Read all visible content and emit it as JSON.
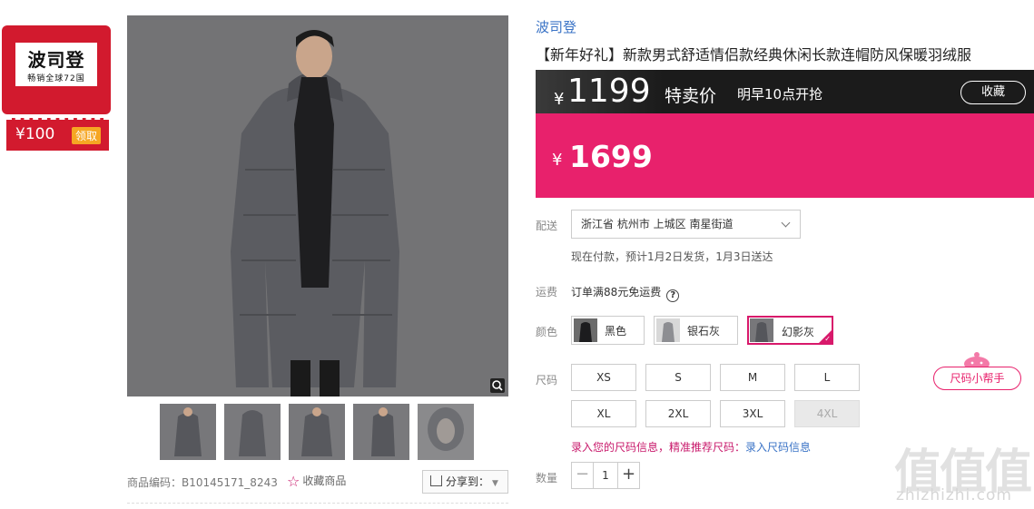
{
  "coupon": {
    "brand": "波司登",
    "slogan": "畅销全球72国",
    "amount": "¥100",
    "claim_label": "领取"
  },
  "gallery": {
    "thumb_count": 5
  },
  "meta": {
    "sku_code": "商品编码：B10145171_8243",
    "favorite_label": "收藏商品",
    "share_label": "分享到："
  },
  "product": {
    "brand": "波司登",
    "title": "【新年好礼】新款男式舒适情侣款经典休闲长款连帽防风保暖羽绒服"
  },
  "flash": {
    "currency": "¥",
    "price": "1199",
    "label": "特卖价",
    "time": "明早10点开抢",
    "favorite_button": "收藏"
  },
  "price": {
    "currency": "¥",
    "value": "1699"
  },
  "delivery": {
    "label": "配送",
    "address": "浙江省 杭州市 上城区 南星街道",
    "note": "现在付款，预计1月2日发货，1月3日送达"
  },
  "freight": {
    "label": "运费",
    "note": "订单满88元免运费",
    "help_icon": "?"
  },
  "colors": {
    "label": "颜色",
    "options": [
      {
        "name": "黑色",
        "selected": false
      },
      {
        "name": "银石灰",
        "selected": false
      },
      {
        "name": "幻影灰",
        "selected": true
      }
    ]
  },
  "sizes": {
    "label": "尺码",
    "options": [
      "XS",
      "S",
      "M",
      "L",
      "XL",
      "2XL",
      "3XL",
      "4XL"
    ],
    "disabled": [
      "4XL"
    ],
    "hint_prefix": "录入您的尺码信息，精准推荐尺码：",
    "hint_link": "录入尺码信息",
    "helper_label": "尺码小帮手"
  },
  "quantity": {
    "label": "数量",
    "value": "1",
    "minus": "−",
    "plus": "+"
  },
  "watermark": {
    "big": "值值值",
    "site": "zhizhizhi.com"
  },
  "colors_theme": {
    "accent": "#e8216c",
    "dark_bar": "#1b1b1b",
    "link": "#3a73c6",
    "coupon_red": "#d21a2e"
  }
}
